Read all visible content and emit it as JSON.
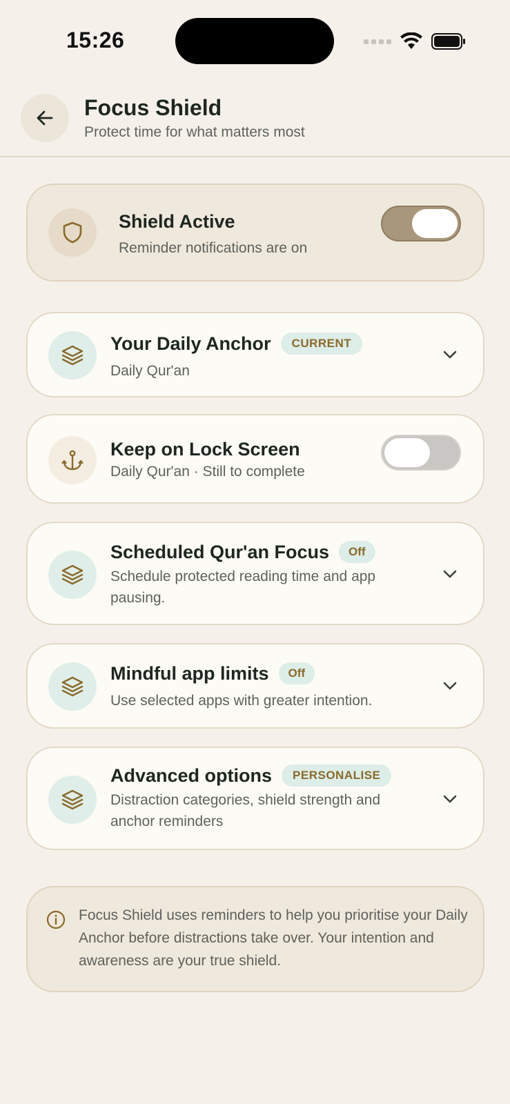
{
  "status_bar": {
    "time": "15:26"
  },
  "header": {
    "title": "Focus Shield",
    "subtitle": "Protect time for what matters most"
  },
  "shield_card": {
    "title": "Shield Active",
    "subtitle": "Reminder notifications are on",
    "toggle_on": true
  },
  "cards": {
    "daily_anchor": {
      "title": "Your Daily Anchor",
      "badge": "CURRENT",
      "subtitle": "Daily Qur'an"
    },
    "lock_screen": {
      "title": "Keep on Lock Screen",
      "subtitle": "Daily Qur'an · Still to complete",
      "toggle_on": false
    },
    "scheduled_focus": {
      "title": "Scheduled Qur'an Focus",
      "badge": "Off",
      "subtitle": "Schedule protected reading time and app pausing."
    },
    "app_limits": {
      "title": "Mindful app limits",
      "badge": "Off",
      "subtitle": "Use selected apps with greater intention."
    },
    "advanced": {
      "title": "Advanced options",
      "badge": "PERSONALISE",
      "subtitle": "Distraction categories, shield strength and anchor reminders"
    }
  },
  "info": {
    "text": "Focus Shield uses reminders to help you prioritise your Daily Anchor before distractions take over. Your intention and awareness are your true shield."
  },
  "colors": {
    "background": "#F5F1EA",
    "accent_gold": "#8A6A2A",
    "teal_chip": "#DDEDE7",
    "toggle_on": "#A8977A"
  },
  "icons": {
    "back": "arrow-left-icon",
    "shield": "shield-icon",
    "layers": "layers-icon",
    "anchor": "anchor-icon",
    "chevron": "chevron-down-icon",
    "info": "info-icon"
  }
}
